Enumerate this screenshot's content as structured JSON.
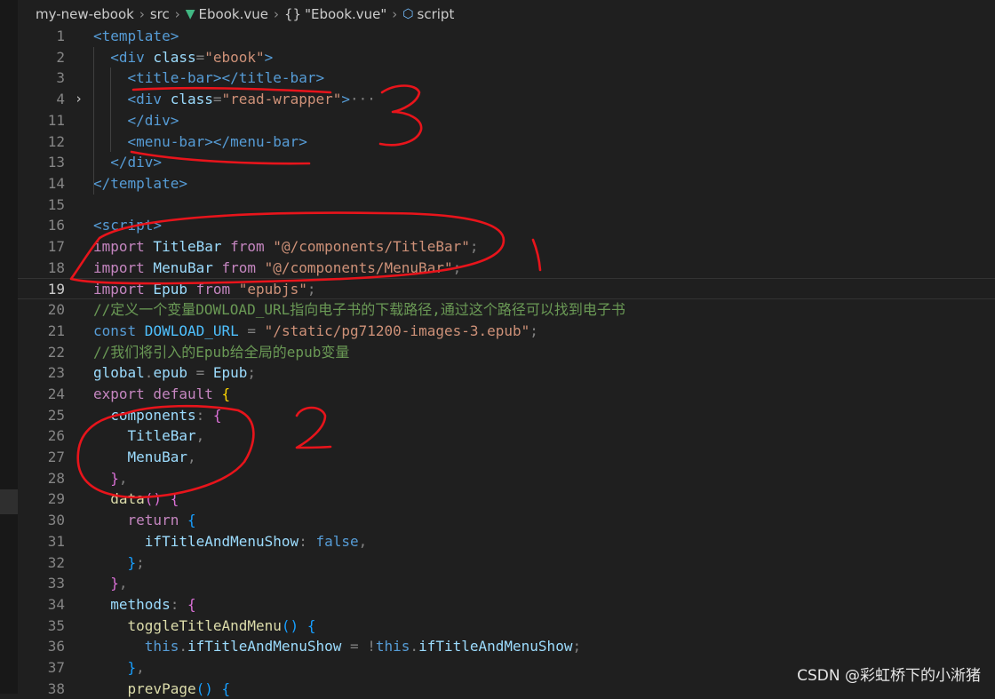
{
  "breadcrumb": {
    "items": [
      "my-new-ebook",
      "src",
      "Ebook.vue",
      "\"Ebook.vue\"",
      "script"
    ],
    "icons": {
      "file": "vue-icon",
      "section": "braces-icon",
      "symbol": "cube-icon"
    }
  },
  "editor": {
    "current_line": "19",
    "folded_line": "4",
    "lines": [
      {
        "n": "1",
        "tokens": [
          [
            "t-tag",
            "<template>"
          ]
        ]
      },
      {
        "n": "2",
        "tokens": [
          [
            "t-tag",
            "  <div"
          ],
          [
            "t-attr",
            " class"
          ],
          [
            "t-punc",
            "="
          ],
          [
            "t-str",
            "\"ebook\""
          ],
          [
            "t-tag",
            ">"
          ]
        ]
      },
      {
        "n": "3",
        "tokens": [
          [
            "t-tag",
            "    <title-bar></title-bar>"
          ]
        ]
      },
      {
        "n": "4",
        "tokens": [
          [
            "t-tag",
            "    <div"
          ],
          [
            "t-attr",
            " class"
          ],
          [
            "t-punc",
            "="
          ],
          [
            "t-str",
            "\"read-wrapper\""
          ],
          [
            "t-tag",
            ">"
          ],
          [
            "t-dots",
            "···"
          ]
        ]
      },
      {
        "n": "11",
        "tokens": [
          [
            "t-tag",
            "    </div>"
          ]
        ]
      },
      {
        "n": "12",
        "tokens": [
          [
            "t-tag",
            "    <menu-bar></menu-bar>"
          ]
        ]
      },
      {
        "n": "13",
        "tokens": [
          [
            "t-tag",
            "  </div>"
          ]
        ]
      },
      {
        "n": "14",
        "tokens": [
          [
            "t-tag",
            "</template>"
          ]
        ]
      },
      {
        "n": "15",
        "tokens": []
      },
      {
        "n": "16",
        "tokens": [
          [
            "t-tag",
            "<script>"
          ]
        ]
      },
      {
        "n": "17",
        "tokens": [
          [
            "t-kw",
            "import"
          ],
          [
            "t-var",
            " TitleBar"
          ],
          [
            "t-kw",
            " from"
          ],
          [
            "t-str",
            " \"@/components/TitleBar\""
          ],
          [
            "t-punc",
            ";"
          ]
        ]
      },
      {
        "n": "18",
        "tokens": [
          [
            "t-kw",
            "import"
          ],
          [
            "t-var",
            " MenuBar"
          ],
          [
            "t-kw",
            " from"
          ],
          [
            "t-str",
            " \"@/components/MenuBar\""
          ],
          [
            "t-punc",
            ";"
          ]
        ]
      },
      {
        "n": "19",
        "tokens": [
          [
            "t-kw",
            "import"
          ],
          [
            "t-var",
            " Epub"
          ],
          [
            "t-kw",
            " from"
          ],
          [
            "t-str",
            " \"epubjs\""
          ],
          [
            "t-punc",
            ";"
          ]
        ]
      },
      {
        "n": "20",
        "tokens": [
          [
            "t-cmt",
            "//定义一个变量DOWLOAD_URL指向电子书的下载路径,通过这个路径可以找到电子书"
          ]
        ]
      },
      {
        "n": "21",
        "tokens": [
          [
            "t-tag",
            "const"
          ],
          [
            "t-const",
            " DOWLOAD_URL"
          ],
          [
            "t-punc",
            " = "
          ],
          [
            "t-str",
            "\"/static/pg71200-images-3.epub\""
          ],
          [
            "t-punc",
            ";"
          ]
        ]
      },
      {
        "n": "22",
        "tokens": [
          [
            "t-cmt",
            "//我们将引入的Epub给全局的epub变量"
          ]
        ]
      },
      {
        "n": "23",
        "tokens": [
          [
            "t-var",
            "global"
          ],
          [
            "t-punc",
            "."
          ],
          [
            "t-var",
            "epub"
          ],
          [
            "t-punc",
            " = "
          ],
          [
            "t-var",
            "Epub"
          ],
          [
            "t-punc",
            ";"
          ]
        ]
      },
      {
        "n": "24",
        "tokens": [
          [
            "t-kw",
            "export"
          ],
          [
            "t-kw",
            " default"
          ],
          [
            "t-brace1",
            " {"
          ]
        ]
      },
      {
        "n": "25",
        "tokens": [
          [
            "t-var",
            "  components"
          ],
          [
            "t-punc",
            ": "
          ],
          [
            "t-brace2",
            "{"
          ]
        ]
      },
      {
        "n": "26",
        "tokens": [
          [
            "t-var",
            "    TitleBar"
          ],
          [
            "t-punc",
            ","
          ]
        ]
      },
      {
        "n": "27",
        "tokens": [
          [
            "t-var",
            "    MenuBar"
          ],
          [
            "t-punc",
            ","
          ]
        ]
      },
      {
        "n": "28",
        "tokens": [
          [
            "t-brace2",
            "  }"
          ],
          [
            "t-punc",
            ","
          ]
        ]
      },
      {
        "n": "29",
        "tokens": [
          [
            "t-fn",
            "  data"
          ],
          [
            "t-brace2",
            "()"
          ],
          [
            "t-brace2",
            " {"
          ]
        ]
      },
      {
        "n": "30",
        "tokens": [
          [
            "t-kw",
            "    return"
          ],
          [
            "t-brace3",
            " {"
          ]
        ]
      },
      {
        "n": "31",
        "tokens": [
          [
            "t-var",
            "      ifTitleAndMenuShow"
          ],
          [
            "t-punc",
            ": "
          ],
          [
            "t-num",
            "false"
          ],
          [
            "t-punc",
            ","
          ]
        ]
      },
      {
        "n": "32",
        "tokens": [
          [
            "t-brace3",
            "    }"
          ],
          [
            "t-punc",
            ";"
          ]
        ]
      },
      {
        "n": "33",
        "tokens": [
          [
            "t-brace2",
            "  }"
          ],
          [
            "t-punc",
            ","
          ]
        ]
      },
      {
        "n": "34",
        "tokens": [
          [
            "t-var",
            "  methods"
          ],
          [
            "t-punc",
            ": "
          ],
          [
            "t-brace2",
            "{"
          ]
        ]
      },
      {
        "n": "35",
        "tokens": [
          [
            "t-fn",
            "    toggleTitleAndMenu"
          ],
          [
            "t-brace3",
            "()"
          ],
          [
            "t-brace3",
            " {"
          ]
        ]
      },
      {
        "n": "36",
        "tokens": [
          [
            "t-num",
            "      this"
          ],
          [
            "t-punc",
            "."
          ],
          [
            "t-var",
            "ifTitleAndMenuShow"
          ],
          [
            "t-punc",
            " = !"
          ],
          [
            "t-num",
            "this"
          ],
          [
            "t-punc",
            "."
          ],
          [
            "t-var",
            "ifTitleAndMenuShow"
          ],
          [
            "t-punc",
            ";"
          ]
        ]
      },
      {
        "n": "37",
        "tokens": [
          [
            "t-brace3",
            "    }"
          ],
          [
            "t-punc",
            ","
          ]
        ]
      },
      {
        "n": "38",
        "tokens": [
          [
            "t-fn",
            "    prevPage"
          ],
          [
            "t-brace3",
            "()"
          ],
          [
            "t-brace3",
            " {"
          ]
        ]
      }
    ]
  },
  "annotations": {
    "labels": [
      "3",
      "1",
      "2"
    ],
    "color": "#e8141b"
  },
  "watermark": "CSDN @彩虹桥下的小淅猪",
  "colors": {
    "background": "#1f1f1f",
    "annotation": "#e8141b"
  }
}
